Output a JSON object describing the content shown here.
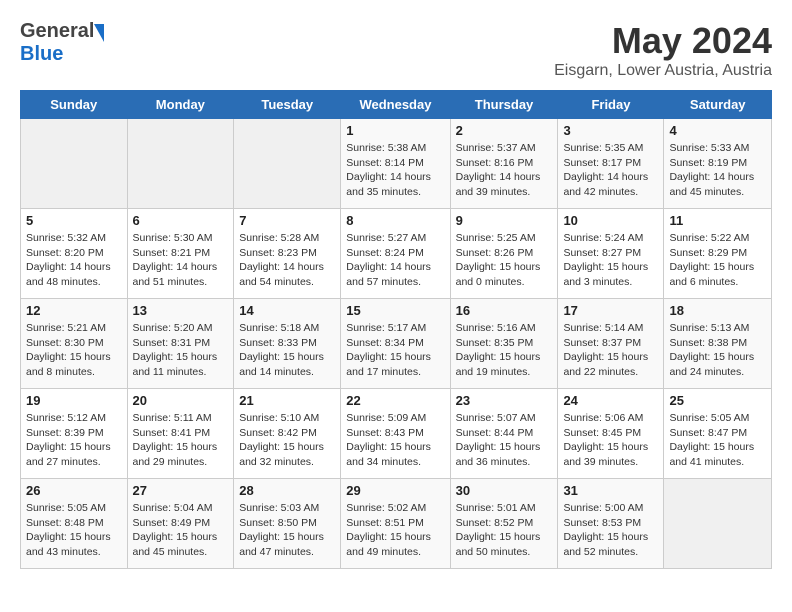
{
  "header": {
    "logo_general": "General",
    "logo_blue": "Blue",
    "title": "May 2024",
    "subtitle": "Eisgarn, Lower Austria, Austria"
  },
  "weekdays": [
    "Sunday",
    "Monday",
    "Tuesday",
    "Wednesday",
    "Thursday",
    "Friday",
    "Saturday"
  ],
  "weeks": [
    [
      {
        "day": "",
        "info": ""
      },
      {
        "day": "",
        "info": ""
      },
      {
        "day": "",
        "info": ""
      },
      {
        "day": "1",
        "info": "Sunrise: 5:38 AM\nSunset: 8:14 PM\nDaylight: 14 hours\nand 35 minutes."
      },
      {
        "day": "2",
        "info": "Sunrise: 5:37 AM\nSunset: 8:16 PM\nDaylight: 14 hours\nand 39 minutes."
      },
      {
        "day": "3",
        "info": "Sunrise: 5:35 AM\nSunset: 8:17 PM\nDaylight: 14 hours\nand 42 minutes."
      },
      {
        "day": "4",
        "info": "Sunrise: 5:33 AM\nSunset: 8:19 PM\nDaylight: 14 hours\nand 45 minutes."
      }
    ],
    [
      {
        "day": "5",
        "info": "Sunrise: 5:32 AM\nSunset: 8:20 PM\nDaylight: 14 hours\nand 48 minutes."
      },
      {
        "day": "6",
        "info": "Sunrise: 5:30 AM\nSunset: 8:21 PM\nDaylight: 14 hours\nand 51 minutes."
      },
      {
        "day": "7",
        "info": "Sunrise: 5:28 AM\nSunset: 8:23 PM\nDaylight: 14 hours\nand 54 minutes."
      },
      {
        "day": "8",
        "info": "Sunrise: 5:27 AM\nSunset: 8:24 PM\nDaylight: 14 hours\nand 57 minutes."
      },
      {
        "day": "9",
        "info": "Sunrise: 5:25 AM\nSunset: 8:26 PM\nDaylight: 15 hours\nand 0 minutes."
      },
      {
        "day": "10",
        "info": "Sunrise: 5:24 AM\nSunset: 8:27 PM\nDaylight: 15 hours\nand 3 minutes."
      },
      {
        "day": "11",
        "info": "Sunrise: 5:22 AM\nSunset: 8:29 PM\nDaylight: 15 hours\nand 6 minutes."
      }
    ],
    [
      {
        "day": "12",
        "info": "Sunrise: 5:21 AM\nSunset: 8:30 PM\nDaylight: 15 hours\nand 8 minutes."
      },
      {
        "day": "13",
        "info": "Sunrise: 5:20 AM\nSunset: 8:31 PM\nDaylight: 15 hours\nand 11 minutes."
      },
      {
        "day": "14",
        "info": "Sunrise: 5:18 AM\nSunset: 8:33 PM\nDaylight: 15 hours\nand 14 minutes."
      },
      {
        "day": "15",
        "info": "Sunrise: 5:17 AM\nSunset: 8:34 PM\nDaylight: 15 hours\nand 17 minutes."
      },
      {
        "day": "16",
        "info": "Sunrise: 5:16 AM\nSunset: 8:35 PM\nDaylight: 15 hours\nand 19 minutes."
      },
      {
        "day": "17",
        "info": "Sunrise: 5:14 AM\nSunset: 8:37 PM\nDaylight: 15 hours\nand 22 minutes."
      },
      {
        "day": "18",
        "info": "Sunrise: 5:13 AM\nSunset: 8:38 PM\nDaylight: 15 hours\nand 24 minutes."
      }
    ],
    [
      {
        "day": "19",
        "info": "Sunrise: 5:12 AM\nSunset: 8:39 PM\nDaylight: 15 hours\nand 27 minutes."
      },
      {
        "day": "20",
        "info": "Sunrise: 5:11 AM\nSunset: 8:41 PM\nDaylight: 15 hours\nand 29 minutes."
      },
      {
        "day": "21",
        "info": "Sunrise: 5:10 AM\nSunset: 8:42 PM\nDaylight: 15 hours\nand 32 minutes."
      },
      {
        "day": "22",
        "info": "Sunrise: 5:09 AM\nSunset: 8:43 PM\nDaylight: 15 hours\nand 34 minutes."
      },
      {
        "day": "23",
        "info": "Sunrise: 5:07 AM\nSunset: 8:44 PM\nDaylight: 15 hours\nand 36 minutes."
      },
      {
        "day": "24",
        "info": "Sunrise: 5:06 AM\nSunset: 8:45 PM\nDaylight: 15 hours\nand 39 minutes."
      },
      {
        "day": "25",
        "info": "Sunrise: 5:05 AM\nSunset: 8:47 PM\nDaylight: 15 hours\nand 41 minutes."
      }
    ],
    [
      {
        "day": "26",
        "info": "Sunrise: 5:05 AM\nSunset: 8:48 PM\nDaylight: 15 hours\nand 43 minutes."
      },
      {
        "day": "27",
        "info": "Sunrise: 5:04 AM\nSunset: 8:49 PM\nDaylight: 15 hours\nand 45 minutes."
      },
      {
        "day": "28",
        "info": "Sunrise: 5:03 AM\nSunset: 8:50 PM\nDaylight: 15 hours\nand 47 minutes."
      },
      {
        "day": "29",
        "info": "Sunrise: 5:02 AM\nSunset: 8:51 PM\nDaylight: 15 hours\nand 49 minutes."
      },
      {
        "day": "30",
        "info": "Sunrise: 5:01 AM\nSunset: 8:52 PM\nDaylight: 15 hours\nand 50 minutes."
      },
      {
        "day": "31",
        "info": "Sunrise: 5:00 AM\nSunset: 8:53 PM\nDaylight: 15 hours\nand 52 minutes."
      },
      {
        "day": "",
        "info": ""
      }
    ]
  ]
}
